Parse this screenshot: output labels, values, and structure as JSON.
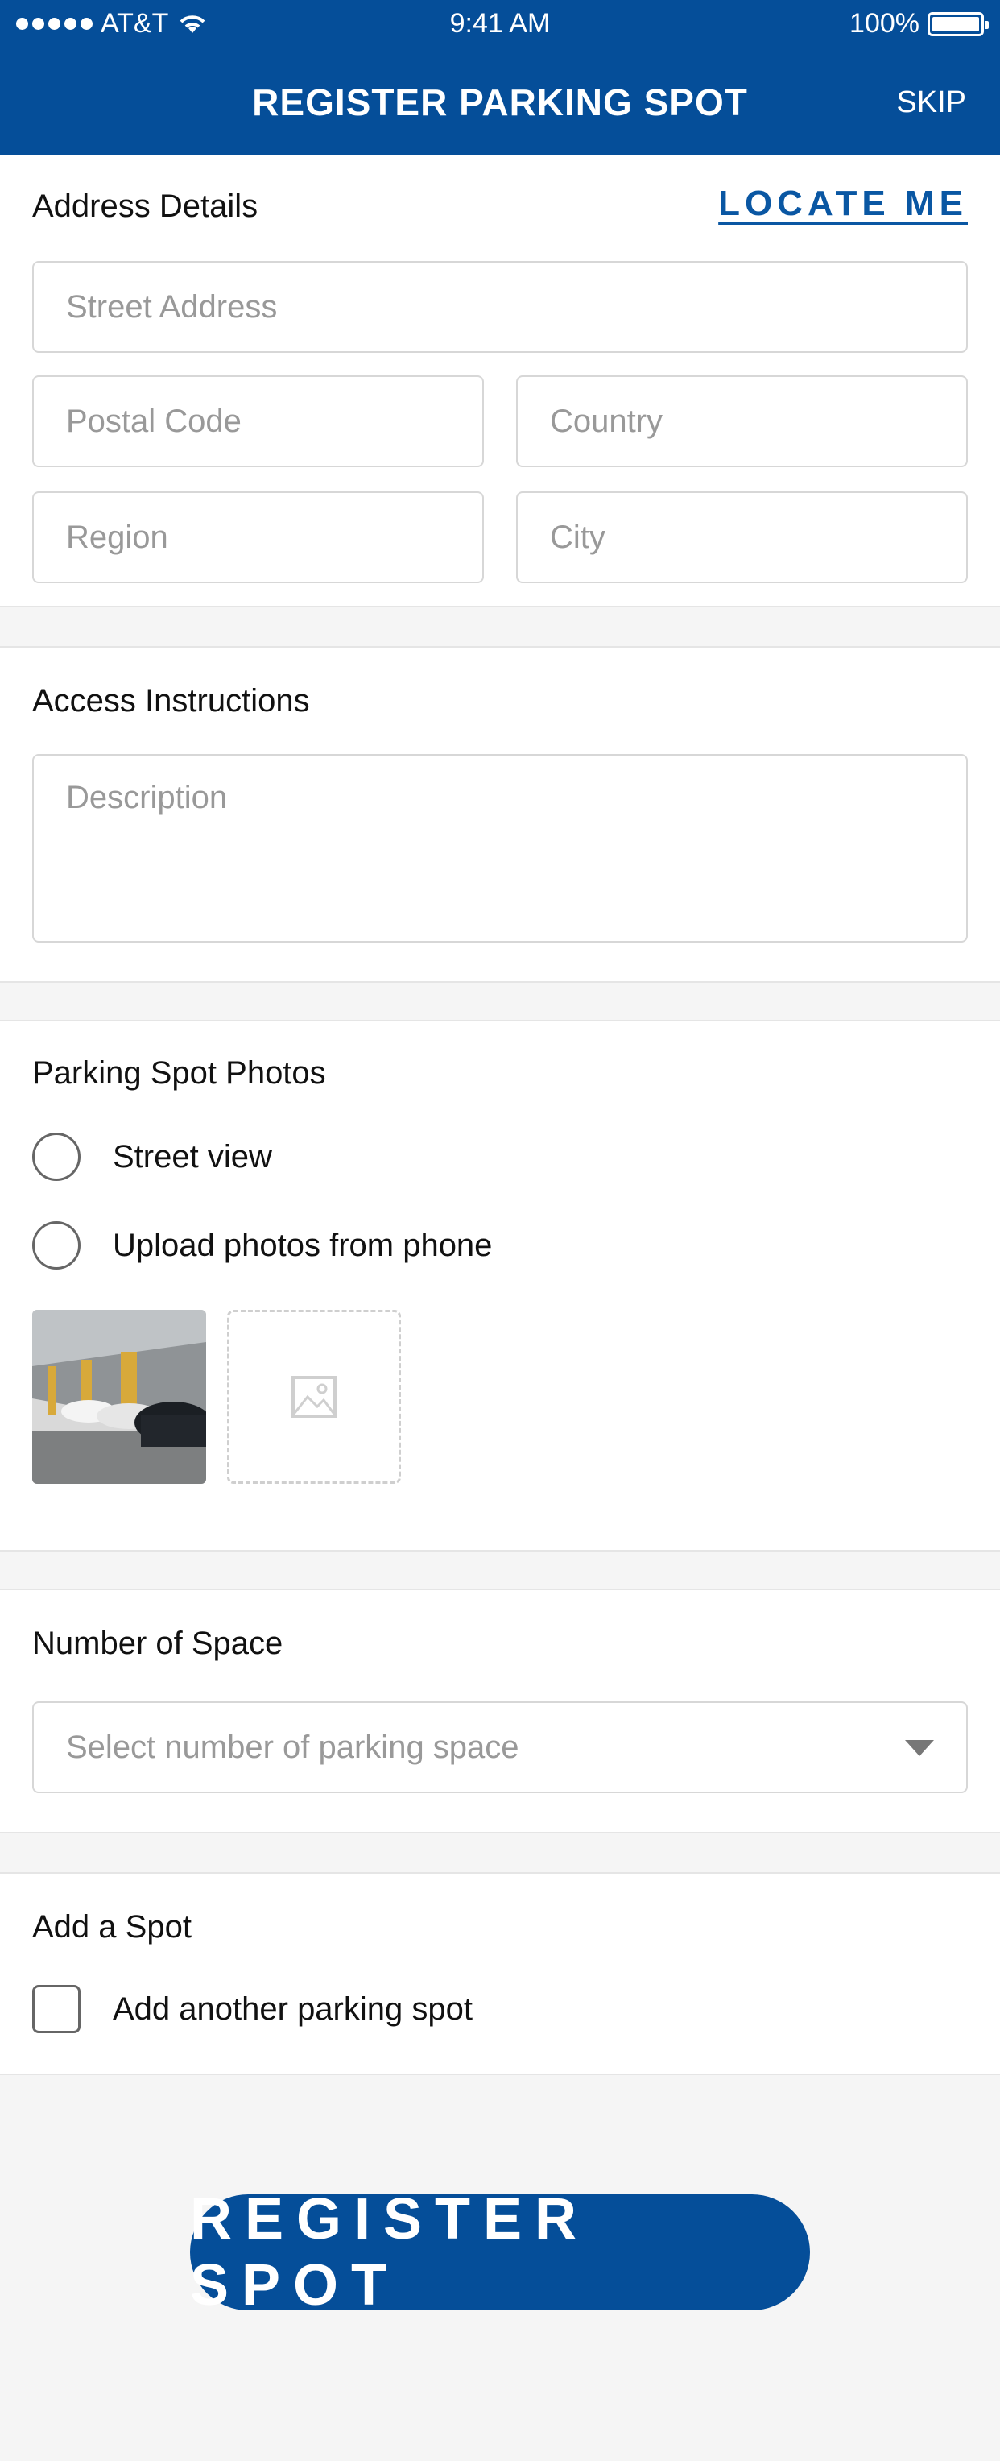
{
  "status_bar": {
    "carrier": "AT&T",
    "time": "9:41 AM",
    "battery": "100%"
  },
  "header": {
    "title": "REGISTER PARKING SPOT",
    "skip": "SKIP"
  },
  "address": {
    "title": "Address Details",
    "locate_me": "LOCATE ME",
    "street_placeholder": "Street Address",
    "postal_placeholder": "Postal Code",
    "country_placeholder": "Country",
    "region_placeholder": "Region",
    "city_placeholder": "City"
  },
  "access": {
    "title": "Access Instructions",
    "description_placeholder": "Description"
  },
  "photos": {
    "title": "Parking Spot Photos",
    "option_street": "Street view",
    "option_upload": "Upload photos from phone"
  },
  "spaces": {
    "title": "Number of Space",
    "select_placeholder": "Select number of parking space"
  },
  "add_spot": {
    "title": "Add a Spot",
    "checkbox_label": "Add another parking spot"
  },
  "register_button": "REGISTER SPOT",
  "colors": {
    "brand": "#054e99",
    "link": "#0a57a3"
  }
}
